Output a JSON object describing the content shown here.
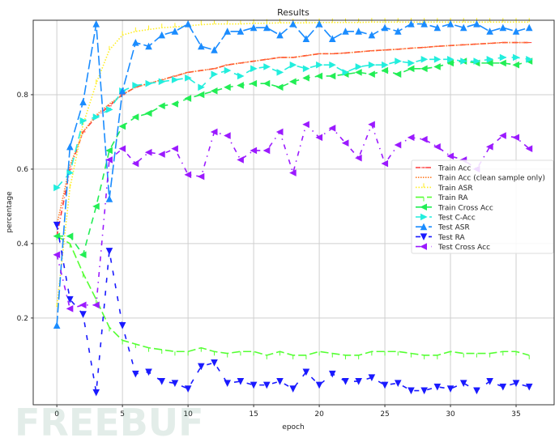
{
  "chart_data": {
    "type": "line",
    "title": "Results",
    "xlabel": "epoch",
    "ylabel": "percentage",
    "xlim": [
      -1.8,
      37.9
    ],
    "ylim": [
      -0.033,
      1.0
    ],
    "xticks": [
      0,
      5,
      10,
      15,
      20,
      25,
      30,
      35
    ],
    "yticks": [
      0.2,
      0.4,
      0.6,
      0.8
    ],
    "grid": true,
    "legend_position": "center-right",
    "x": [
      0,
      1,
      2,
      3,
      4,
      5,
      6,
      7,
      8,
      9,
      10,
      11,
      12,
      13,
      14,
      15,
      16,
      17,
      18,
      19,
      20,
      21,
      22,
      23,
      24,
      25,
      26,
      27,
      28,
      29,
      30,
      31,
      32,
      33,
      34,
      35,
      36
    ],
    "series": [
      {
        "name": "Train Acc",
        "color": "#ff3b3b",
        "dash": "6 3 1 3",
        "marker": "hline",
        "values": [
          0.42,
          0.6,
          0.7,
          0.74,
          0.77,
          0.8,
          0.82,
          0.83,
          0.84,
          0.85,
          0.86,
          0.865,
          0.87,
          0.88,
          0.885,
          0.89,
          0.895,
          0.9,
          0.9,
          0.905,
          0.91,
          0.91,
          0.912,
          0.915,
          0.918,
          0.92,
          0.922,
          0.925,
          0.927,
          0.93,
          0.932,
          0.934,
          0.936,
          0.938,
          0.94,
          0.94,
          0.94
        ]
      },
      {
        "name": "Train Acc (clean sample only)",
        "color": "#ff7f2a",
        "dash": "1.5 1.5",
        "marker": "none",
        "values": [
          0.45,
          0.61,
          0.7,
          0.745,
          0.775,
          0.8,
          0.82,
          0.83,
          0.84,
          0.85,
          0.86,
          0.865,
          0.87,
          0.88,
          0.885,
          0.89,
          0.895,
          0.9,
          0.9,
          0.905,
          0.91,
          0.91,
          0.912,
          0.915,
          0.918,
          0.92,
          0.922,
          0.925,
          0.927,
          0.93,
          0.932,
          0.934,
          0.936,
          0.938,
          0.94,
          0.94,
          0.94
        ]
      },
      {
        "name": "Train ASR",
        "color": "#ffee22",
        "dash": "1.5 2",
        "marker": "vline",
        "values": [
          0.23,
          0.55,
          0.72,
          0.83,
          0.92,
          0.96,
          0.97,
          0.975,
          0.98,
          0.982,
          0.985,
          0.988,
          0.99,
          0.99,
          0.99,
          0.992,
          0.992,
          0.993,
          0.993,
          0.993,
          0.994,
          0.994,
          0.994,
          0.994,
          0.995,
          0.995,
          0.995,
          0.995,
          0.995,
          0.995,
          0.995,
          0.995,
          0.995,
          0.995,
          0.995,
          0.995,
          0.995
        ]
      },
      {
        "name": "Train RA",
        "color": "#55ff33",
        "dash": "10 4",
        "marker": "tick",
        "values": [
          0.42,
          0.4,
          0.32,
          0.25,
          0.175,
          0.14,
          0.13,
          0.12,
          0.115,
          0.11,
          0.11,
          0.12,
          0.11,
          0.105,
          0.11,
          0.11,
          0.1,
          0.11,
          0.1,
          0.1,
          0.11,
          0.105,
          0.1,
          0.1,
          0.11,
          0.11,
          0.11,
          0.105,
          0.1,
          0.1,
          0.11,
          0.105,
          0.105,
          0.105,
          0.11,
          0.11,
          0.1
        ]
      },
      {
        "name": "Train Cross Acc",
        "color": "#22ee55",
        "dash": "8 6",
        "marker": "tri-left",
        "values": [
          0.42,
          0.42,
          0.37,
          0.5,
          0.65,
          0.715,
          0.74,
          0.75,
          0.77,
          0.775,
          0.79,
          0.8,
          0.81,
          0.82,
          0.825,
          0.83,
          0.83,
          0.82,
          0.835,
          0.845,
          0.85,
          0.85,
          0.855,
          0.86,
          0.855,
          0.865,
          0.855,
          0.87,
          0.87,
          0.875,
          0.885,
          0.89,
          0.885,
          0.885,
          0.885,
          0.88,
          0.89
        ]
      },
      {
        "name": "Test C-Acc",
        "color": "#22eedd",
        "dash": "10 7",
        "marker": "tri-right",
        "values": [
          0.55,
          0.59,
          0.73,
          0.74,
          0.76,
          0.81,
          0.825,
          0.83,
          0.835,
          0.84,
          0.845,
          0.82,
          0.855,
          0.865,
          0.85,
          0.87,
          0.875,
          0.86,
          0.88,
          0.87,
          0.88,
          0.88,
          0.86,
          0.875,
          0.88,
          0.88,
          0.89,
          0.885,
          0.895,
          0.895,
          0.895,
          0.89,
          0.89,
          0.895,
          0.9,
          0.9,
          0.895
        ]
      },
      {
        "name": "Test ASR",
        "color": "#1a8cff",
        "dash": "12 4",
        "marker": "tri-up",
        "values": [
          0.18,
          0.66,
          0.78,
          0.99,
          0.52,
          0.81,
          0.94,
          0.93,
          0.96,
          0.97,
          0.99,
          0.93,
          0.92,
          0.97,
          0.97,
          0.98,
          0.98,
          0.96,
          0.99,
          0.95,
          0.99,
          0.95,
          0.97,
          0.97,
          0.96,
          0.98,
          0.97,
          0.99,
          0.99,
          0.98,
          0.99,
          0.98,
          0.99,
          0.97,
          0.98,
          0.97,
          0.98
        ]
      },
      {
        "name": "Test RA",
        "color": "#1a1aff",
        "dash": "6 10",
        "marker": "tri-down",
        "values": [
          0.45,
          0.25,
          0.21,
          0.0,
          0.38,
          0.18,
          0.05,
          0.055,
          0.03,
          0.025,
          0.01,
          0.07,
          0.08,
          0.025,
          0.03,
          0.02,
          0.02,
          0.03,
          0.01,
          0.055,
          0.02,
          0.05,
          0.03,
          0.03,
          0.04,
          0.02,
          0.025,
          0.005,
          0.005,
          0.015,
          0.01,
          0.025,
          0.005,
          0.03,
          0.015,
          0.025,
          0.015
        ]
      },
      {
        "name": "Test Cross Acc",
        "color": "#9b1aff",
        "dash": "6 6 1.5 6",
        "marker": "tri-left",
        "values": [
          0.37,
          0.225,
          0.235,
          0.235,
          0.625,
          0.655,
          0.615,
          0.645,
          0.64,
          0.655,
          0.585,
          0.58,
          0.7,
          0.69,
          0.625,
          0.65,
          0.65,
          0.7,
          0.59,
          0.72,
          0.685,
          0.71,
          0.67,
          0.63,
          0.72,
          0.615,
          0.665,
          0.685,
          0.68,
          0.66,
          0.635,
          0.625,
          0.6,
          0.66,
          0.69,
          0.685,
          0.655
        ]
      }
    ]
  },
  "watermark": "FREEBUF"
}
